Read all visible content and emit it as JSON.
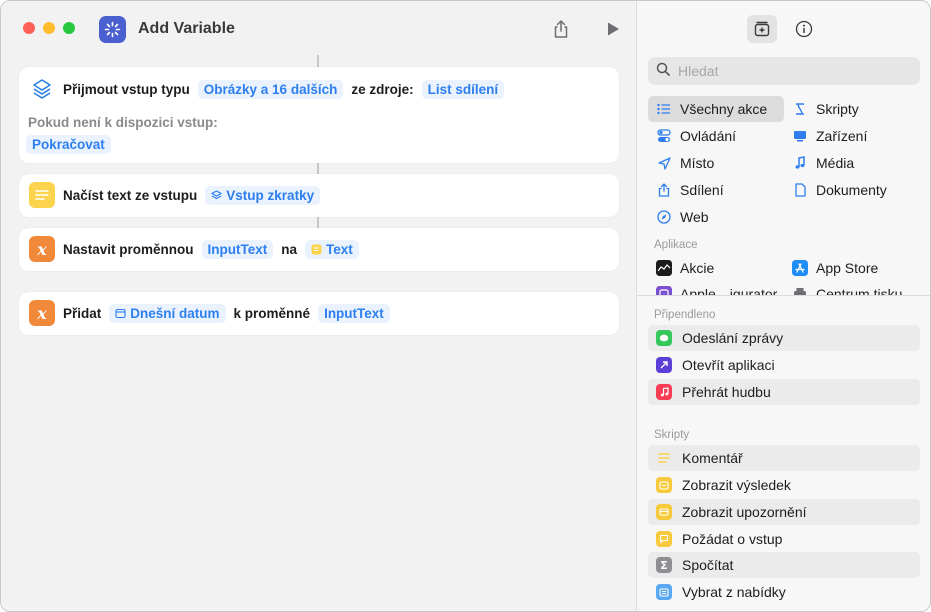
{
  "window": {
    "title": "Add Variable"
  },
  "toolbar": {
    "share_icon": "share-icon",
    "run_icon": "play-icon"
  },
  "editor": {
    "actions": [
      {
        "icon": "receive-input-icon",
        "label": "Přijmout vstup typu",
        "type_token": "Obrázky a 16 dalších",
        "source_label": "ze zdroje:",
        "source_token": "List sdílení",
        "fallback_label": "Pokud není k dispozici vstup:",
        "fallback_token": "Pokračovat"
      },
      {
        "icon": "text-icon",
        "label": "Načíst text ze vstupu",
        "token": "Vstup zkratky"
      },
      {
        "icon": "variable-x-icon",
        "label": "Nastavit proměnnou",
        "variable_token": "InputText",
        "connector": "na",
        "value_token": "Text"
      },
      {
        "icon": "variable-x-icon",
        "label": "Přidat",
        "value_token": "Dnešní datum",
        "connector": "k proměnné",
        "variable_token": "InputText"
      }
    ]
  },
  "library": {
    "search_placeholder": "Hledat",
    "categories": [
      {
        "label": "Všechny akce",
        "icon": "list-icon",
        "selected": true
      },
      {
        "label": "Skripty",
        "icon": "scripts-icon"
      },
      {
        "label": "Ovládání",
        "icon": "toggle-icon"
      },
      {
        "label": "Zařízení",
        "icon": "display-icon"
      },
      {
        "label": "Místo",
        "icon": "location-icon"
      },
      {
        "label": "Média",
        "icon": "music-note-icon"
      },
      {
        "label": "Sdílení",
        "icon": "share-icon"
      },
      {
        "label": "Dokumenty",
        "icon": "document-icon"
      },
      {
        "label": "Web",
        "icon": "compass-icon"
      }
    ],
    "apps_header": "Aplikace",
    "apps": [
      {
        "label": "Akcie",
        "icon": "stocks-icon"
      },
      {
        "label": "App Store",
        "icon": "app-store-icon"
      },
      {
        "label": "Apple…igurator",
        "icon": "configurator-icon"
      },
      {
        "label": "Centrum tisku",
        "icon": "printer-icon"
      }
    ],
    "pinned_header": "Připendleno",
    "pinned": [
      {
        "label": "Odeslání zprávy",
        "color": "#34c759",
        "icon": "message-icon"
      },
      {
        "label": "Otevřít aplikaci",
        "color": "#5b3fd6",
        "icon": "open-app-icon"
      },
      {
        "label": "Přehrát hudbu",
        "color": "#fa3c55",
        "icon": "music-note-icon"
      }
    ],
    "scripts_header": "Skripty",
    "scripts": [
      {
        "label": "Komentář",
        "color": "#fdd24c",
        "icon": "comment-lines-icon"
      },
      {
        "label": "Zobrazit výsledek",
        "color": "#f7c93c",
        "icon": "show-result-icon"
      },
      {
        "label": "Zobrazit upozornění",
        "color": "#f7c93c",
        "icon": "alert-icon"
      },
      {
        "label": "Požádat o vstup",
        "color": "#f7c93c",
        "icon": "ask-input-icon"
      },
      {
        "label": "Spočítat",
        "color": "#8e8e93",
        "icon": "sigma-icon"
      },
      {
        "label": "Vybrat z nabídky",
        "color": "#5aa9f0",
        "icon": "menu-icon"
      }
    ]
  }
}
